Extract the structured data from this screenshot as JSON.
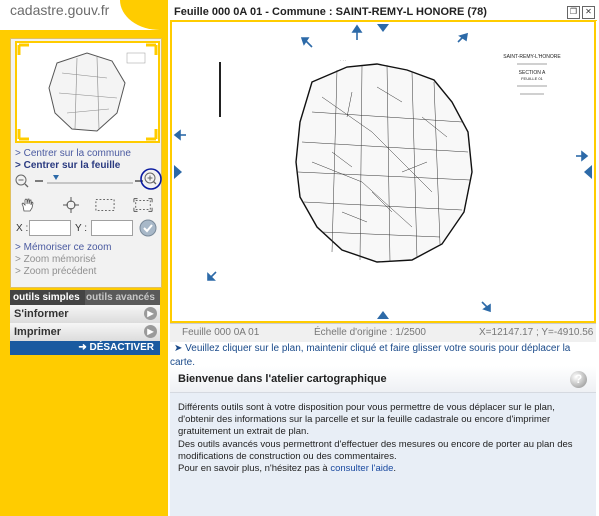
{
  "logo": "cadastre.gouv.fr",
  "header": {
    "title": "Feuille 000 0A 01 - Commune : SAINT-REMY-L HONORE (78)"
  },
  "nav": {
    "center_commune": "> Centrer sur la commune",
    "center_sheet": "> Centrer sur la feuille",
    "memorize_zoom": "> Mémoriser ce zoom",
    "memorized_zoom": "> Zoom mémorisé",
    "previous_zoom": "> Zoom précédent"
  },
  "coords": {
    "x_label": "X :",
    "y_label": "Y :",
    "x_value": "",
    "y_value": ""
  },
  "tabs": {
    "simple": "outils simples",
    "advanced": "outils avancés"
  },
  "menu": {
    "inform": "S'informer",
    "print": "Imprimer",
    "deactivate": "➜ DÉSACTIVER"
  },
  "status": {
    "sheet": "Feuille 000 0A 01",
    "scale": "Échelle d'origine : 1/2500",
    "coords": "X=12147.17 ; Y=-4910.56"
  },
  "hint": "➤ Veuillez cliquer sur le plan, maintenir cliqué et faire glisser votre souris pour déplacer la carte.",
  "welcome": {
    "title": "Bienvenue dans l'atelier cartographique",
    "p1": "Différents outils sont à votre disposition pour vous permettre de vous déplacer sur le plan, d'obtenir des informations sur la parcelle et sur la feuille cadastrale ou encore d'imprimer gratuitement un extrait de plan.",
    "p2": "Des outils avancés vous permettront d'effectuer des mesures ou encore de porter au plan des modifications de construction ou des commentaires.",
    "p3_prefix": "Pour en savoir plus, n'hésitez pas à ",
    "p3_link": "consulter l'aide",
    "p3_suffix": "."
  },
  "map": {
    "sheet_header": "SAINT-REMY-L'HONORE",
    "sheet_section": "SECTION A",
    "sheet_feuille": "FEUILLE 01"
  },
  "colors": {
    "brand_yellow": "#ffcc00",
    "accent_blue": "#2d6aa8",
    "highlight_circle": "#0a1aa0"
  },
  "icons": [
    "pan-hand-icon",
    "center-target-icon",
    "select-box-icon",
    "dashed-box-icon",
    "check-circle-icon",
    "zoom-out-icon",
    "zoom-in-icon",
    "help-icon"
  ]
}
